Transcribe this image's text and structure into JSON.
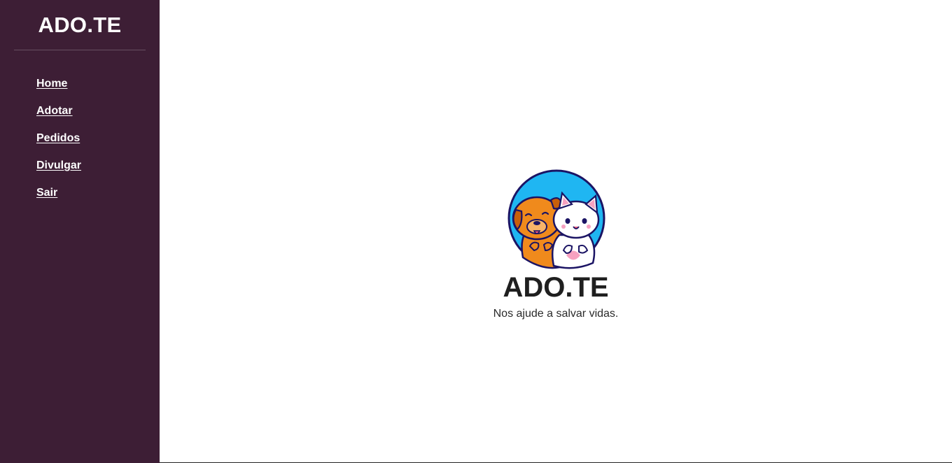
{
  "sidebar": {
    "brand": "ADO.TE",
    "items": [
      {
        "label": "Home"
      },
      {
        "label": "Adotar"
      },
      {
        "label": "Pedidos"
      },
      {
        "label": "Divulgar"
      },
      {
        "label": "Sair"
      }
    ]
  },
  "main": {
    "logo_icon": "dog-and-cat-logo-icon",
    "title": "ADO.TE",
    "subtitle": "Nos ajude a salvar vidas."
  },
  "colors": {
    "sidebar_bg": "#3d1e35",
    "logo_circle": "#1fb6f2",
    "dog": "#f08a1c",
    "cat": "#ffffff",
    "outline": "#1b1464"
  }
}
